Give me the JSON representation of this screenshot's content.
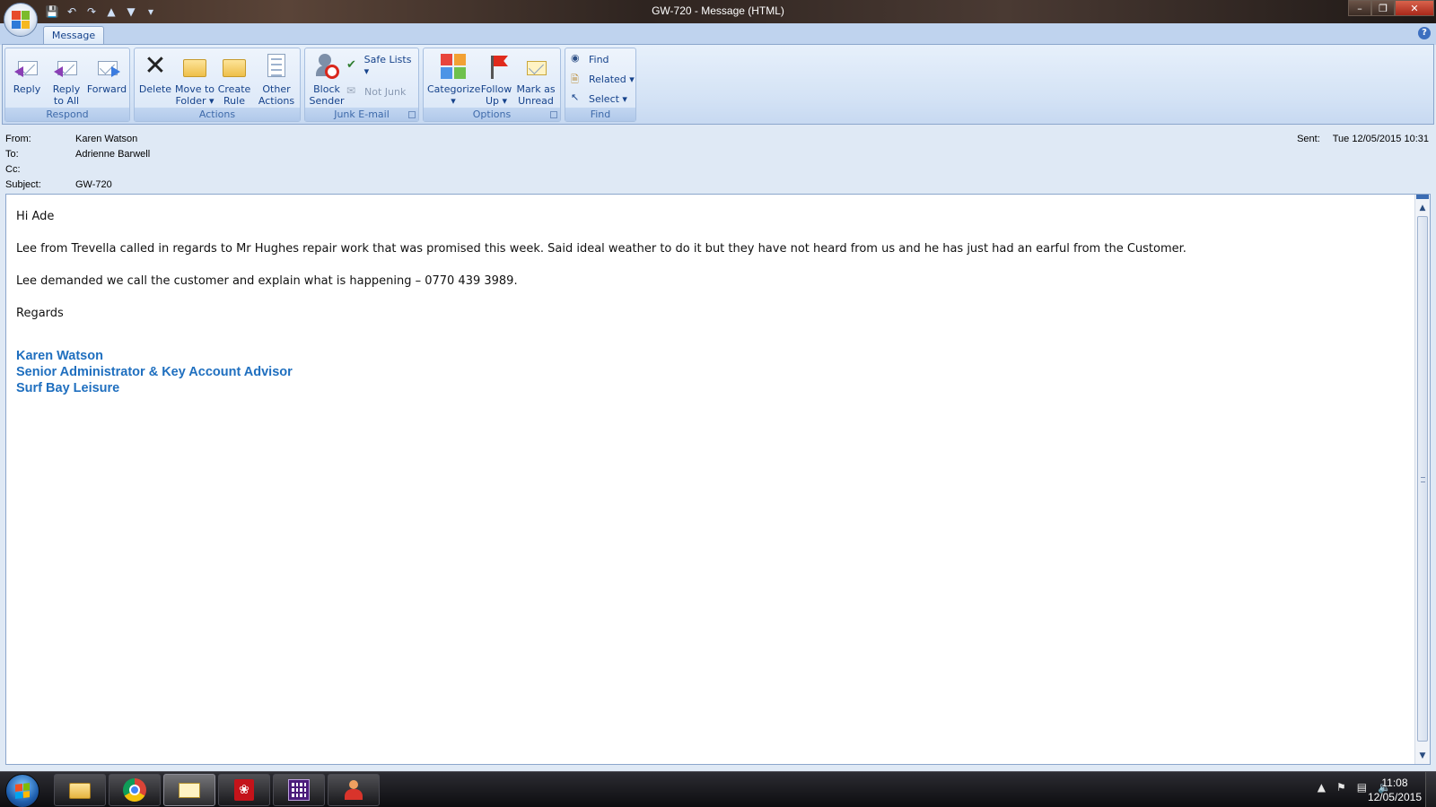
{
  "window": {
    "title": "GW-720 - Message (HTML)",
    "minimize_glyph": "–",
    "restore_glyph": "❐",
    "close_glyph": "✕"
  },
  "ribbon": {
    "tab": "Message",
    "help_glyph": "?",
    "groups": {
      "respond": {
        "label": "Respond",
        "reply": "Reply",
        "reply_all": [
          "Reply",
          "to All"
        ],
        "forward": "Forward"
      },
      "actions": {
        "label": "Actions",
        "delete": "Delete",
        "move_to_folder": [
          "Move to",
          "Folder ▾"
        ],
        "create_rule": [
          "Create",
          "Rule"
        ],
        "other_actions": [
          "Other",
          "Actions ▾"
        ]
      },
      "junk": {
        "label": "Junk E-mail",
        "block_sender": [
          "Block",
          "Sender"
        ],
        "safe_lists": "Safe Lists ▾",
        "not_junk": "Not Junk"
      },
      "options": {
        "label": "Options",
        "categorize": [
          "Categorize",
          "▾"
        ],
        "follow_up": [
          "Follow",
          "Up ▾"
        ],
        "mark_unread": [
          "Mark as",
          "Unread"
        ]
      },
      "find": {
        "label": "Find",
        "find": "Find",
        "related": "Related ▾",
        "select": "Select ▾"
      }
    }
  },
  "header": {
    "from_label": "From:",
    "from": "Karen Watson",
    "to_label": "To:",
    "to": "Adrienne Barwell",
    "cc_label": "Cc:",
    "cc": "",
    "subject_label": "Subject:",
    "subject": "GW-720",
    "sent_label": "Sent:",
    "sent": "Tue 12/05/2015 10:31"
  },
  "message": {
    "greeting": "Hi Ade",
    "para1": "Lee from Trevella called in regards to Mr Hughes repair work that was promised this week. Said ideal weather to do it but they have not heard from us and he has just had an earful from the Customer.",
    "para2": "Lee demanded we call the customer and explain what is happening – 0770 439 3989.",
    "closing": "Regards",
    "signature": {
      "name": "Karen Watson",
      "title": "Senior Administrator & Key Account Advisor",
      "company": "Surf Bay Leisure",
      "color": "#1f6fbf"
    }
  },
  "taskbar": {
    "apps": [
      "file-explorer",
      "chrome",
      "outlook",
      "adobe-reader",
      "calculator-app",
      "contacts-app"
    ],
    "clock_time": "11:08",
    "clock_date": "12/05/2015"
  }
}
